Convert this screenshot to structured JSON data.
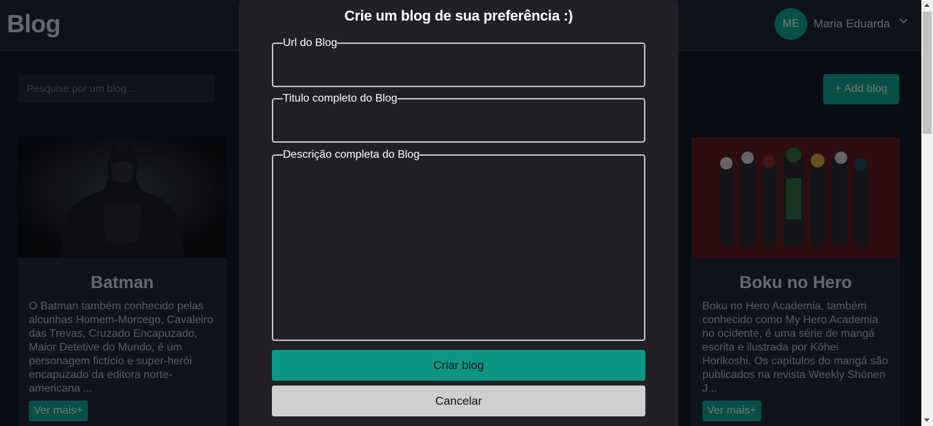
{
  "header": {
    "logo": "Blog",
    "user_initials": "ME",
    "user_name": "Maria Eduarda"
  },
  "toolbar": {
    "search_placeholder": "Pesquise por um blog...",
    "add_label": "+ Add blog"
  },
  "cards": [
    {
      "title": "Batman",
      "text": "O Batman também conhecido pelas alcunhas Homem-Morcego, Cavaleiro das Trevas, Cruzado Encapuzado, Maior Detetive do Mundo, é um personagem fictício e super-herói encapuzado da editora norte-americana ...",
      "button": "Ver mais+"
    },
    {
      "title": "Boku no Hero",
      "text": "Boku no Hero Academia, também conhecido como My Hero Academia no ocidente, é uma série de mangá escrita e ilustrada por Kōhei Horikoshi. Os capítulos do mangá são publicados na revista Weekly Shōnen J...",
      "button": "Ver mais+"
    }
  ],
  "modal": {
    "title": "Crie um blog de sua preferência :)",
    "url_label": "Url do Blog",
    "title_label": "Titulo completo do Blog",
    "desc_label": "Descrição completa do Blog",
    "url_value": "",
    "title_value": "",
    "desc_value": "",
    "create_label": "Criar blog",
    "cancel_label": "Cancelar"
  },
  "colors": {
    "accent": "#0e9f8e",
    "page_background": "#0f1a24",
    "modal_background": "#222024",
    "cancel_button": "#cfcfcf"
  }
}
